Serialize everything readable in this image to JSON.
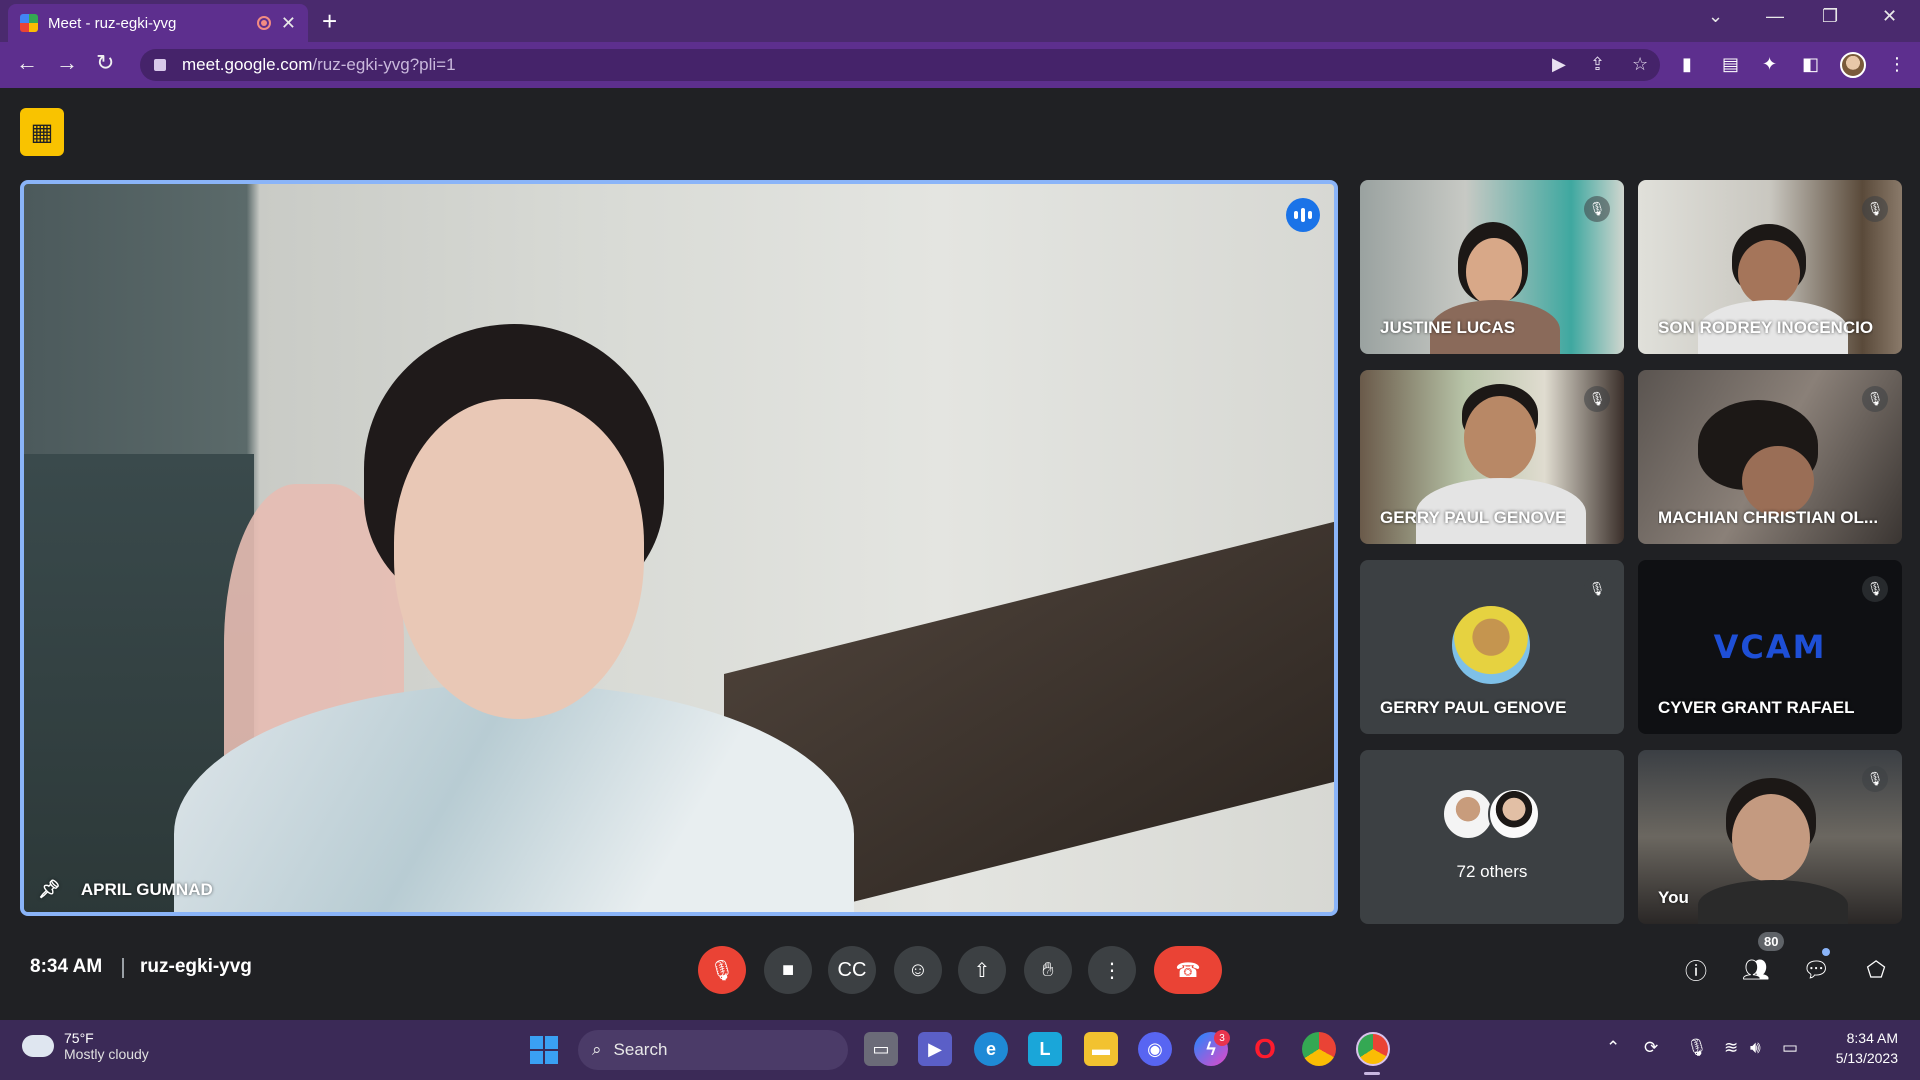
{
  "browser": {
    "tab_title": "Meet - ruz-egki-yvg",
    "url_host": "meet.google.com",
    "url_path": "/ruz-egki-yvg?pli=1"
  },
  "meeting": {
    "main_speaker": "APRIL GUMNAD",
    "tiles": [
      {
        "name": "JUSTINE LUCAS"
      },
      {
        "name": "SON RODREY INOCENCIO"
      },
      {
        "name": "GERRY PAUL GENOVE"
      },
      {
        "name": "MACHIAN CHRISTIAN OL..."
      },
      {
        "name": "GERRY PAUL GENOVE"
      },
      {
        "name": "CYVER GRANT RAFAEL",
        "logo_text": "VCAM"
      },
      {
        "name": "72 others"
      },
      {
        "name": "You"
      }
    ],
    "time": "8:34 AM",
    "code": "ruz-egki-yvg",
    "participant_count": "80"
  },
  "taskbar": {
    "temperature": "75°F",
    "weather": "Mostly cloudy",
    "search_label": "Search",
    "messenger_badge": "3",
    "clock_time": "8:34 AM",
    "clock_date": "5/13/2023"
  },
  "colors": {
    "accent_blue": "#8ab4f8",
    "end_call_red": "#ea4335",
    "browser_purple": "#5d2f8e"
  }
}
